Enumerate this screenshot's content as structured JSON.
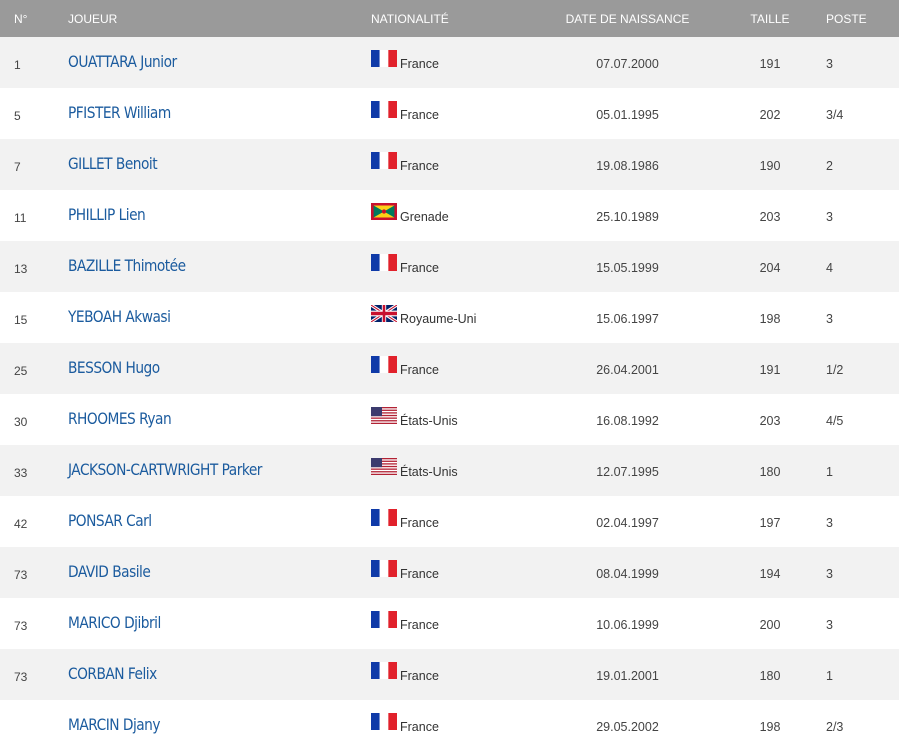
{
  "header": {
    "num": "N°",
    "player": "JOUEUR",
    "nationality": "NATIONALITÉ",
    "birthdate": "DATE DE NAISSANCE",
    "height": "TAILLE",
    "position": "POSTE"
  },
  "colors": {
    "header_bg": "#9a9a9a",
    "name_link": "#1b5b9e",
    "row_alt": "#f2f2f2"
  },
  "players": [
    {
      "num": "1",
      "name": "OUATTARA Junior",
      "flag": "france-flag-icon",
      "nationality": "France",
      "birthdate": "07.07.2000",
      "height": "191",
      "position": "3"
    },
    {
      "num": "5",
      "name": "PFISTER William",
      "flag": "france-flag-icon",
      "nationality": "France",
      "birthdate": "05.01.1995",
      "height": "202",
      "position": "3/4"
    },
    {
      "num": "7",
      "name": "GILLET Benoit",
      "flag": "france-flag-icon",
      "nationality": "France",
      "birthdate": "19.08.1986",
      "height": "190",
      "position": "2"
    },
    {
      "num": "11",
      "name": "PHILLIP Lien",
      "flag": "grenada-flag-icon",
      "nationality": "Grenade",
      "birthdate": "25.10.1989",
      "height": "203",
      "position": "3"
    },
    {
      "num": "13",
      "name": "BAZILLE Thimotée",
      "flag": "france-flag-icon",
      "nationality": "France",
      "birthdate": "15.05.1999",
      "height": "204",
      "position": "4"
    },
    {
      "num": "15",
      "name": "YEBOAH Akwasi",
      "flag": "united-kingdom-flag-icon",
      "nationality": "Royaume-Uni",
      "birthdate": "15.06.1997",
      "height": "198",
      "position": "3"
    },
    {
      "num": "25",
      "name": "BESSON Hugo",
      "flag": "france-flag-icon",
      "nationality": "France",
      "birthdate": "26.04.2001",
      "height": "191",
      "position": "1/2"
    },
    {
      "num": "30",
      "name": "RHOOMES Ryan",
      "flag": "united-states-flag-icon",
      "nationality": "États-Unis",
      "birthdate": "16.08.1992",
      "height": "203",
      "position": "4/5"
    },
    {
      "num": "33",
      "name": "JACKSON-CARTWRIGHT Parker",
      "flag": "united-states-flag-icon",
      "nationality": "États-Unis",
      "birthdate": "12.07.1995",
      "height": "180",
      "position": "1"
    },
    {
      "num": "42",
      "name": "PONSAR Carl",
      "flag": "france-flag-icon",
      "nationality": "France",
      "birthdate": "02.04.1997",
      "height": "197",
      "position": "3"
    },
    {
      "num": "73",
      "name": "DAVID Basile",
      "flag": "france-flag-icon",
      "nationality": "France",
      "birthdate": "08.04.1999",
      "height": "194",
      "position": "3"
    },
    {
      "num": "73",
      "name": "MARICO Djibril",
      "flag": "france-flag-icon",
      "nationality": "France",
      "birthdate": "10.06.1999",
      "height": "200",
      "position": "3"
    },
    {
      "num": "73",
      "name": "CORBAN Felix",
      "flag": "france-flag-icon",
      "nationality": "France",
      "birthdate": "19.01.2001",
      "height": "180",
      "position": "1"
    },
    {
      "num": "",
      "name": "MARCIN Djany",
      "flag": "france-flag-icon",
      "nationality": "France",
      "birthdate": "29.05.2002",
      "height": "198",
      "position": "2/3"
    }
  ]
}
